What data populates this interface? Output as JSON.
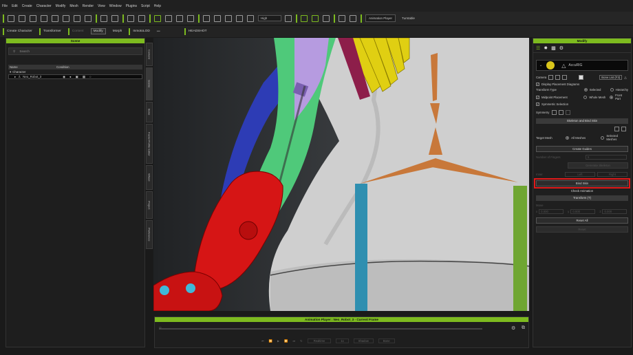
{
  "menu": [
    "File",
    "Edit",
    "Create",
    "Character",
    "Modify",
    "Mesh",
    "Render",
    "View",
    "Window",
    "Plugins",
    "Script",
    "Help"
  ],
  "toolbar1": {
    "quality": "High",
    "animation_player": "Animation Player",
    "turntable": "Turntable"
  },
  "toolbar2": {
    "create_character": "Create Character",
    "transformer": "Transformer",
    "content_dim": "Content",
    "modify": "Modify",
    "morph": "Morph",
    "inmotion": "InmotoLOD",
    "headshot": "HEADSHOT"
  },
  "scene": {
    "title": "Scene",
    "search_placeholder": "Search",
    "columns": [
      "Name",
      "Condition"
    ],
    "group": "Character",
    "item": "Neo_Robot_3"
  },
  "vtabs": [
    "Content",
    "Scene",
    "Bone",
    "Facial Profile Editor",
    "Wheel",
    "Project",
    "Preference"
  ],
  "anim": {
    "title": "Animation Player : Neo_Robot_3 - Current Frame",
    "realtime": "Realtime",
    "speed": "1x",
    "shadow": "Shadow",
    "bone": "Bone"
  },
  "modify": {
    "title": "Modify",
    "accurig_label": "AccuRIG",
    "camera_label": "Camera",
    "bone_list_button": "Bone List (F3)",
    "display_placement": "Display Placement Diagrams",
    "transform_type": "Transform Type",
    "selected": "Selected",
    "hierarchy": "Hierarchy",
    "midpoint": "Midpoint Placement",
    "whole_mesh": "Whole Mesh",
    "front_part": "Front Part",
    "symmetric": "Symmetric Selection",
    "symmetry": "Symmetry",
    "skeleton_section": "Skeleton and Bind Skin",
    "target_mesh": "Target Mesh",
    "all_meshes": "All Meshes",
    "selected_meshes": "Selected Meshes",
    "create_guides": "Create Guides",
    "number_of_fingers": "Number of Fingers",
    "fingers_value": "5",
    "generate_skeleton": "Generate Skeleton",
    "inner": "Inner",
    "left": "Left",
    "right": "Right",
    "bind_skin": "Bind Skin",
    "check_animation": "Check Animation",
    "transform_section": "Transform (T)",
    "move": "Move",
    "x_val": "0.000",
    "y_val": "0.000",
    "z_val": "0.000",
    "reset_all": "Reset All",
    "reset": "Reset"
  },
  "colors": {
    "accent": "#7dbb1f",
    "highlight": "#e21a1a"
  }
}
